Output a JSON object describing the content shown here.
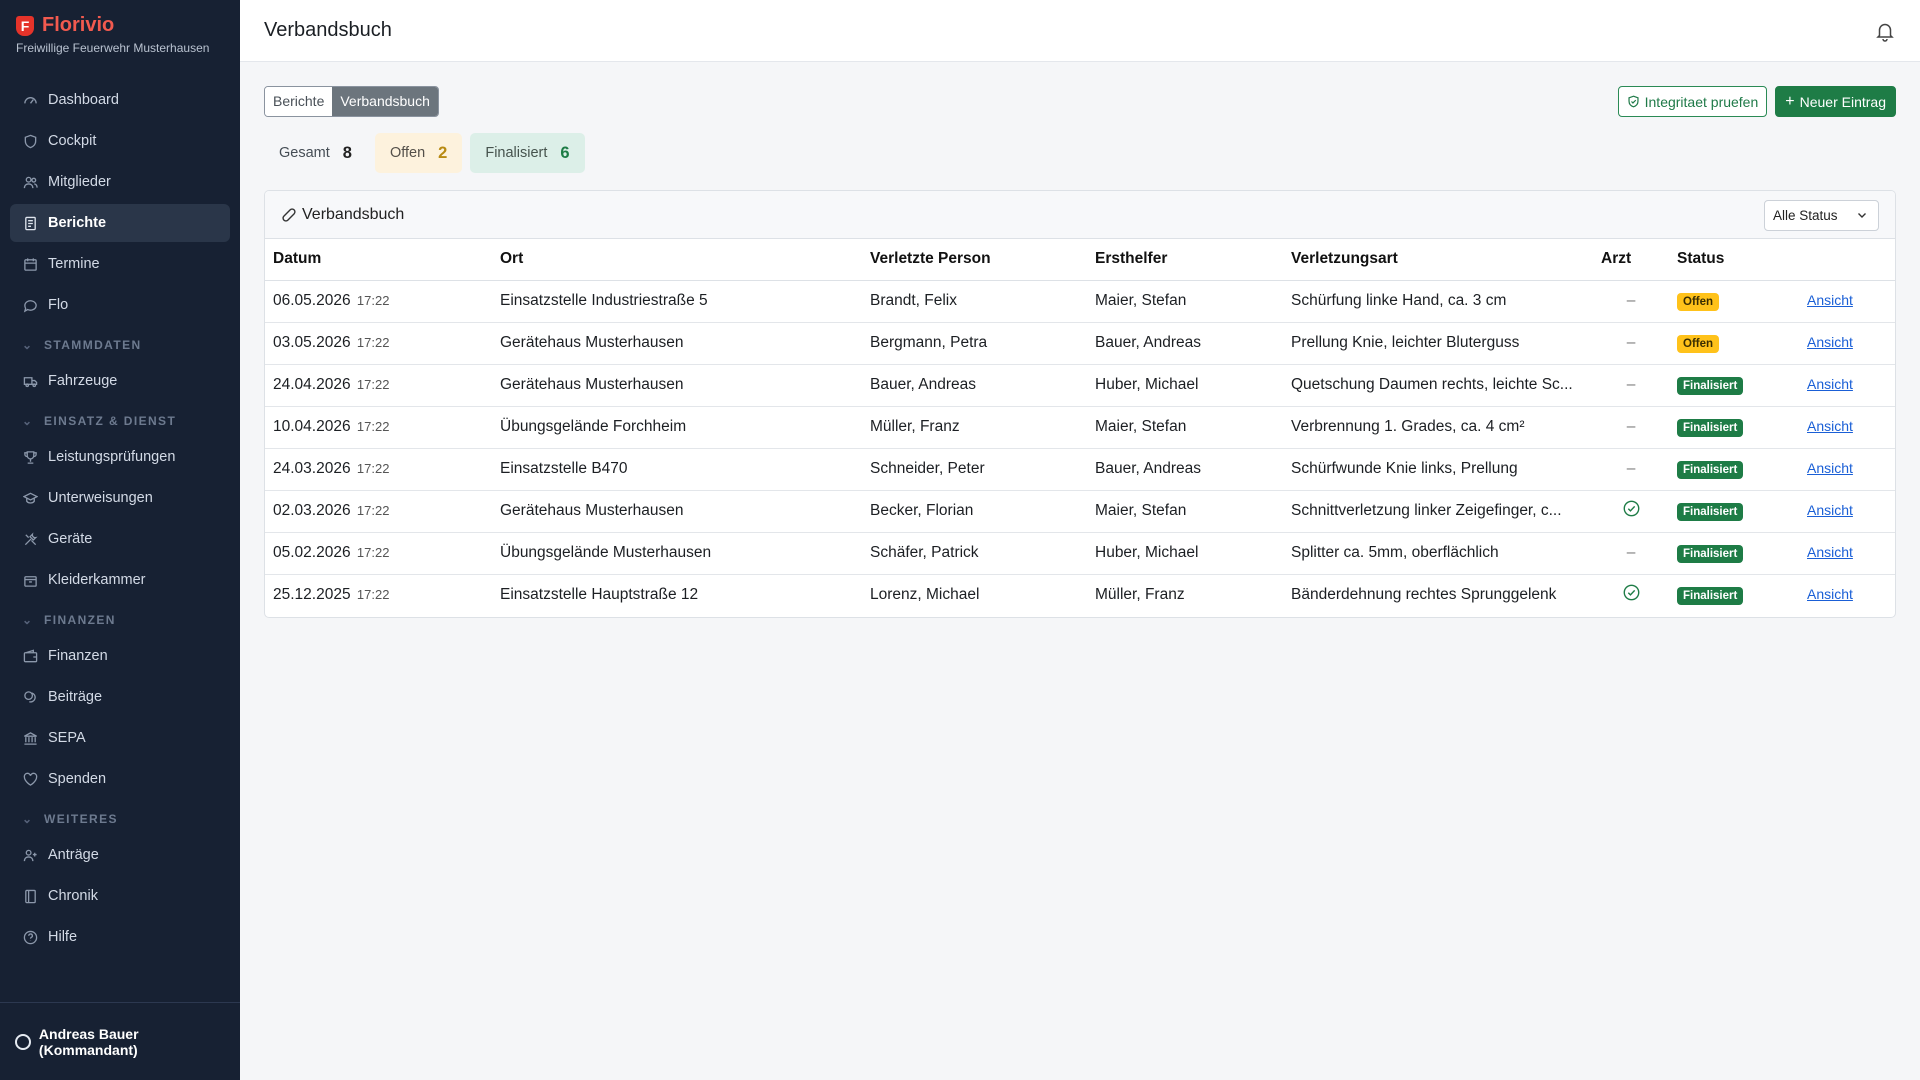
{
  "app": {
    "logo_letter": "F",
    "name": "Florivio",
    "org": "Freiwillige Feuerwehr Musterhausen"
  },
  "sidebar": {
    "items": [
      {
        "label": "Dashboard",
        "icon": "dashboard-icon"
      },
      {
        "label": "Cockpit",
        "icon": "shield-icon"
      },
      {
        "label": "Mitglieder",
        "icon": "users-icon"
      },
      {
        "label": "Berichte",
        "icon": "report-icon",
        "active": true
      },
      {
        "label": "Termine",
        "icon": "calendar-icon"
      },
      {
        "label": "Flo",
        "icon": "chat-icon"
      }
    ],
    "sections": [
      {
        "title": "STAMMDATEN",
        "items": [
          {
            "label": "Fahrzeuge",
            "icon": "truck-icon"
          }
        ]
      },
      {
        "title": "EINSATZ & DIENST",
        "items": [
          {
            "label": "Leistungsprüfungen",
            "icon": "trophy-icon"
          },
          {
            "label": "Unterweisungen",
            "icon": "graduation-icon"
          },
          {
            "label": "Geräte",
            "icon": "tools-icon"
          },
          {
            "label": "Kleiderkammer",
            "icon": "box-icon"
          }
        ]
      },
      {
        "title": "FINANZEN",
        "items": [
          {
            "label": "Finanzen",
            "icon": "wallet-icon"
          },
          {
            "label": "Beiträge",
            "icon": "coins-icon"
          },
          {
            "label": "SEPA",
            "icon": "bank-icon"
          },
          {
            "label": "Spenden",
            "icon": "heart-icon"
          }
        ]
      },
      {
        "title": "WEITERES",
        "items": [
          {
            "label": "Anträge",
            "icon": "user-plus-icon"
          },
          {
            "label": "Chronik",
            "icon": "book-icon"
          },
          {
            "label": "Hilfe",
            "icon": "help-icon"
          }
        ]
      }
    ],
    "user": "Andreas Bauer (Kommandant)"
  },
  "header": {
    "title": "Verbandsbuch"
  },
  "toolbar": {
    "tabs": [
      {
        "label": "Berichte",
        "active": false
      },
      {
        "label": "Verbandsbuch",
        "active": true
      }
    ],
    "integrity_label": "Integritaet pruefen",
    "new_label": "Neuer Eintrag"
  },
  "stats": {
    "total_label": "Gesamt",
    "total": "8",
    "open_label": "Offen",
    "open": "2",
    "done_label": "Finalisiert",
    "done": "6"
  },
  "card": {
    "title": "Verbandsbuch",
    "filter_value": "Alle Status"
  },
  "table": {
    "columns": [
      "Datum",
      "Ort",
      "Verletzte Person",
      "Ersthelfer",
      "Verletzungsart",
      "Arzt",
      "Status",
      ""
    ],
    "rows": [
      {
        "date": "06.05.2026",
        "time": "17:22",
        "ort": "Einsatzstelle Industriestraße 5",
        "person": "Brandt, Felix",
        "helfer": "Maier, Stefan",
        "art": "Schürfung linke Hand, ca. 3 cm",
        "arzt": "–",
        "status": "Offen",
        "action": "Ansicht"
      },
      {
        "date": "03.05.2026",
        "time": "17:22",
        "ort": "Gerätehaus Musterhausen",
        "person": "Bergmann, Petra",
        "helfer": "Bauer, Andreas",
        "art": "Prellung Knie, leichter Bluterguss",
        "arzt": "–",
        "status": "Offen",
        "action": "Ansicht"
      },
      {
        "date": "24.04.2026",
        "time": "17:22",
        "ort": "Gerätehaus Musterhausen",
        "person": "Bauer, Andreas",
        "helfer": "Huber, Michael",
        "art": "Quetschung Daumen rechts, leichte Sc...",
        "arzt": "–",
        "status": "Finalisiert",
        "action": "Ansicht"
      },
      {
        "date": "10.04.2026",
        "time": "17:22",
        "ort": "Übungsgelände Forchheim",
        "person": "Müller, Franz",
        "helfer": "Maier, Stefan",
        "art": "Verbrennung 1. Grades, ca. 4 cm²",
        "arzt": "–",
        "status": "Finalisiert",
        "action": "Ansicht"
      },
      {
        "date": "24.03.2026",
        "time": "17:22",
        "ort": "Einsatzstelle B470",
        "person": "Schneider, Peter",
        "helfer": "Bauer, Andreas",
        "art": "Schürfwunde Knie links, Prellung",
        "arzt": "–",
        "status": "Finalisiert",
        "action": "Ansicht"
      },
      {
        "date": "02.03.2026",
        "time": "17:22",
        "ort": "Gerätehaus Musterhausen",
        "person": "Becker, Florian",
        "helfer": "Maier, Stefan",
        "art": "Schnittverletzung linker Zeigefinger, c...",
        "arzt": "check",
        "status": "Finalisiert",
        "action": "Ansicht"
      },
      {
        "date": "05.02.2026",
        "time": "17:22",
        "ort": "Übungsgelände Musterhausen",
        "person": "Schäfer, Patrick",
        "helfer": "Huber, Michael",
        "art": "Splitter ca. 5mm, oberflächlich",
        "arzt": "–",
        "status": "Finalisiert",
        "action": "Ansicht"
      },
      {
        "date": "25.12.2025",
        "time": "17:22",
        "ort": "Einsatzstelle Hauptstraße 12",
        "person": "Lorenz, Michael",
        "helfer": "Müller, Franz",
        "art": "Bänderdehnung rechtes Sprunggelenk",
        "arzt": "check",
        "status": "Finalisiert",
        "action": "Ansicht"
      }
    ]
  }
}
